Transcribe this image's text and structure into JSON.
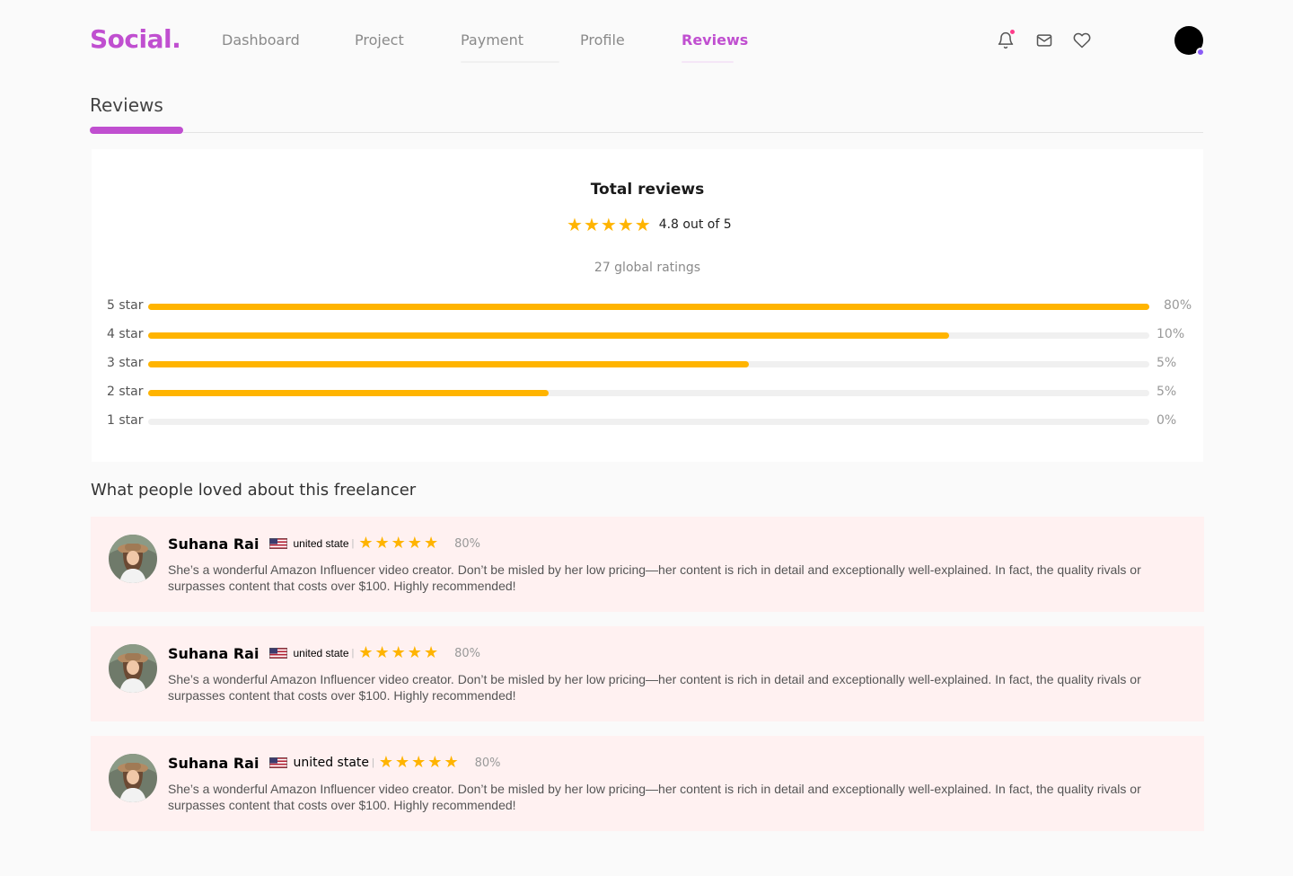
{
  "header": {
    "logo": "Social.",
    "nav": [
      {
        "label": "Dashboard"
      },
      {
        "label": "Project"
      },
      {
        "label": "Payment"
      },
      {
        "label": "Profile"
      },
      {
        "label": "Reviews"
      }
    ],
    "active_nav": "Reviews",
    "notification_unread": true,
    "accent_color": "#c04fd0"
  },
  "page": {
    "title": "Reviews"
  },
  "summary": {
    "title": "Total reviews",
    "stars": 5,
    "rating_text": "4.8 out of 5",
    "global_ratings": "27 global ratings",
    "bars": [
      {
        "label": "5 star",
        "fill_fraction": 1.0,
        "percent": "80%"
      },
      {
        "label": "4 star",
        "fill_fraction": 0.8,
        "percent": "10%"
      },
      {
        "label": "3 star",
        "fill_fraction": 0.6,
        "percent": "5%"
      },
      {
        "label": "2 star",
        "fill_fraction": 0.4,
        "percent": "5%"
      },
      {
        "label": "1 star",
        "fill_fraction": 0.0,
        "percent": "0%"
      }
    ],
    "bar_color": "#ffb400"
  },
  "loved": {
    "title": "What people loved about this freelancer"
  },
  "reviews": [
    {
      "name": "Suhana Rai",
      "country": "united state",
      "stars": 5,
      "percent": "80%",
      "text": "She’s a wonderful Amazon Influencer video creator. Don’t be misled by her low pricing—her content is rich in detail and exceptionally well-explained. In fact, the quality rivals or surpasses content that costs over $100. Highly recommended!"
    },
    {
      "name": "Suhana Rai",
      "country": "united state",
      "stars": 5,
      "percent": "80%",
      "text": "She’s a wonderful Amazon Influencer video creator. Don’t be misled by her low pricing—her content is rich in detail and exceptionally well-explained. In fact, the quality rivals or surpasses content that costs over $100. Highly recommended!"
    },
    {
      "name": "Suhana Rai",
      "country": "united state",
      "stars": 5,
      "percent": "80%",
      "text": "She’s a wonderful Amazon Influencer video creator. Don’t be misled by her low pricing—her content is rich in detail and exceptionally well-explained. In fact, the quality rivals or surpasses content that costs over $100. Highly recommended!"
    }
  ],
  "icons": [
    "bell-icon",
    "mail-icon",
    "heart-icon",
    "star-icon",
    "us-flag-icon"
  ]
}
